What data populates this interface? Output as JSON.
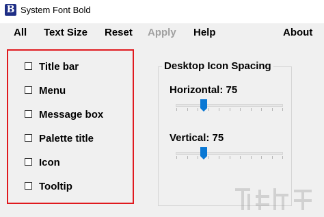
{
  "window": {
    "title": "System Font Bold",
    "icon_letter": "B"
  },
  "menu": {
    "all": "All",
    "text_size": "Text Size",
    "reset": "Reset",
    "apply": "Apply",
    "help": "Help",
    "about": "About"
  },
  "options": [
    {
      "label": "Title bar",
      "checked": false
    },
    {
      "label": "Menu",
      "checked": false
    },
    {
      "label": "Message box",
      "checked": false
    },
    {
      "label": "Palette title",
      "checked": false
    },
    {
      "label": "Icon",
      "checked": false
    },
    {
      "label": "Tooltip",
      "checked": false
    }
  ],
  "spacing": {
    "group_title": "Desktop Icon Spacing",
    "horizontal": {
      "label": "Horizontal: 75",
      "value": 75
    },
    "vertical": {
      "label": "Vertical: 75",
      "value": 75
    }
  },
  "colors": {
    "accent": "#0a78d4",
    "highlight_border": "#e0191e",
    "disabled_text": "#a0a0a0"
  }
}
